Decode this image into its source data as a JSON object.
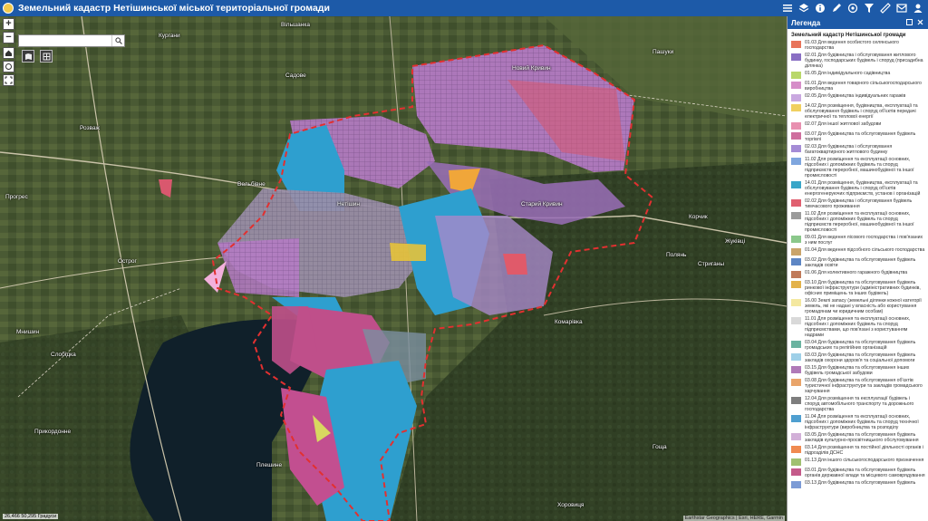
{
  "header": {
    "title": "Земельний кадастр Нетішинської міської територіальної громади"
  },
  "toolbar": {
    "tools": [
      "list-icon",
      "layers-icon",
      "info-icon",
      "draw-icon",
      "print-icon",
      "filter-icon",
      "measure-icon",
      "share-icon",
      "user-icon"
    ]
  },
  "search": {
    "placeholder": "",
    "value": ""
  },
  "map_controls": {
    "zoom_in": "+",
    "zoom_out": "−"
  },
  "scale": {
    "text": "26,466 50,295 Градуси"
  },
  "attribution": {
    "text": "Earthstar Geographics | Esri, HERE, Garmin"
  },
  "places": [
    {
      "name": "Нетішин"
    },
    {
      "name": "Старий Кривин"
    },
    {
      "name": "Новий Кривин"
    },
    {
      "name": "Вельбівне"
    },
    {
      "name": "Корчик"
    },
    {
      "name": "Стриганы"
    },
    {
      "name": "Комарівка"
    },
    {
      "name": "Пашуки"
    },
    {
      "name": "Хоровиця"
    },
    {
      "name": "Полянь"
    },
    {
      "name": "Жуківці"
    },
    {
      "name": "Садове"
    },
    {
      "name": "Розваж"
    },
    {
      "name": "Острог"
    },
    {
      "name": "Прогрес"
    },
    {
      "name": "Мнишин"
    },
    {
      "name": "Слобідка"
    },
    {
      "name": "Прикордонне"
    },
    {
      "name": "Кургани"
    },
    {
      "name": "Вільшанка"
    },
    {
      "name": "Плешине"
    },
    {
      "name": "Гоща"
    }
  ],
  "legend": {
    "title": "Легенда",
    "layer_title": "Земельний кадастр Нетішинської громади",
    "items": [
      {
        "label": "01.03 Для ведення особистого селянського господарства",
        "color": "#e8745a"
      },
      {
        "label": "02.01 Для будівництва і обслуговування житлового будинку, господарських будівель і споруд (присадибна ділянка)",
        "color": "#8a6fc4"
      },
      {
        "label": "01.05 Для індивідуального садівництва",
        "color": "#b9d86a"
      },
      {
        "label": "01.01 Для ведення товарного сільськогосподарського виробництва",
        "color": "#d68ec9"
      },
      {
        "label": "02.05 Для будівництва індивідуальних гаражів",
        "color": "#c9a8e0"
      },
      {
        "label": "14.02 Для розміщення, будівництва, експлуатації та обслуговування будівель і споруд об'єктів передачі електричної та теплової енергії",
        "color": "#f0d060"
      },
      {
        "label": "02.07 Для іншої житлової забудови",
        "color": "#e890b0"
      },
      {
        "label": "03.07 Для будівництва та обслуговування будівель торгівлі",
        "color": "#cf6f9e"
      },
      {
        "label": "02.03 Для будівництва і обслуговування багатоквартирного житлового будинку",
        "color": "#a58cd6"
      },
      {
        "label": "11.02 Для розміщення та експлуатації основних, підсобних і допоміжних будівель та споруд підприємств переробної, машинобудівної та іншої промисловості",
        "color": "#7fa6de"
      },
      {
        "label": "14.01 Для розміщення, будівництва, експлуатації та обслуговування будівель і споруд об'єктів енергогенеруючих підприємств, установ і організацій",
        "color": "#3aa6c8"
      },
      {
        "label": "02.02 Для будівництва і обслуговування будівель тимчасового проживання",
        "color": "#e06070"
      },
      {
        "label": "11.02 Для розміщення та експлуатації основних, підсобних і допоміжних будівель та споруд підприємств переробної, машинобудівної та іншої промисловості",
        "color": "#9b9b9b"
      },
      {
        "label": "09.01 Для ведення лісового господарства і пов'язаних з ним послуг",
        "color": "#8bc88b"
      },
      {
        "label": "01.04 Для ведення підсобного сільського господарства",
        "color": "#caa46a"
      },
      {
        "label": "03.02 Для будівництва та обслуговування будівель закладів освіти",
        "color": "#5d86c4"
      },
      {
        "label": "01.06 Для колективного гаражного будівництва",
        "color": "#c07a5a"
      },
      {
        "label": "03.10 Для будівництва та обслуговування будівель ринкової інфраструктури (адміністративних будинків, офісних приміщень та інших будівель)",
        "color": "#e3b24a"
      },
      {
        "label": "16.00 Землі запасу (земельні ділянки кожної категорії земель, які не надані у власність або користування громадянам чи юридичним особам)",
        "color": "#f4e8a0"
      },
      {
        "label": "11.01 Для розміщення та експлуатації основних, підсобних і допоміжних будівель та споруд підприємствами, що пов'язані з користуванням надрами",
        "color": "#d9d9d9"
      },
      {
        "label": "03.04 Для будівництва та обслуговування будівель громадських та релігійних організацій",
        "color": "#6bb3a0"
      },
      {
        "label": "03.03 Для будівництва та обслуговування будівель закладів охорони здоров'я та соціальної допомоги",
        "color": "#9fd0e8"
      },
      {
        "label": "03.15 Для будівництва та обслуговування інших будівель громадської забудови",
        "color": "#b07ab8"
      },
      {
        "label": "03.08 Для будівництва та обслуговування об'єктів туристичної інфраструктури та закладів громадського харчування",
        "color": "#e9a46a"
      },
      {
        "label": "12.04 Для розміщення та експлуатації будівель і споруд автомобільного транспорту та дорожнього господарства",
        "color": "#7e7e7e"
      },
      {
        "label": "11.04 Для розміщення та експлуатації основних, підсобних і допоміжних будівель та споруд технічної інфраструктури (виробництва та розподілу",
        "color": "#4f9fd0"
      },
      {
        "label": "03.05 Для будівництва та обслуговування будівель закладів культурно-просвітницького обслуговування",
        "color": "#d2b0d8"
      },
      {
        "label": "03.14 Для розміщення та постійної діяльності органів і підрозділів ДСНС",
        "color": "#f08a50"
      },
      {
        "label": "01.13 Для іншого сільськогосподарського призначення",
        "color": "#a0c070"
      },
      {
        "label": "03.01 Для будівництва та обслуговування будівель органів державної влади та місцевого самоврядування",
        "color": "#c45a8a"
      },
      {
        "label": "03.13 Для будівництва та обслуговування будівель",
        "color": "#7c9bd6"
      }
    ]
  }
}
